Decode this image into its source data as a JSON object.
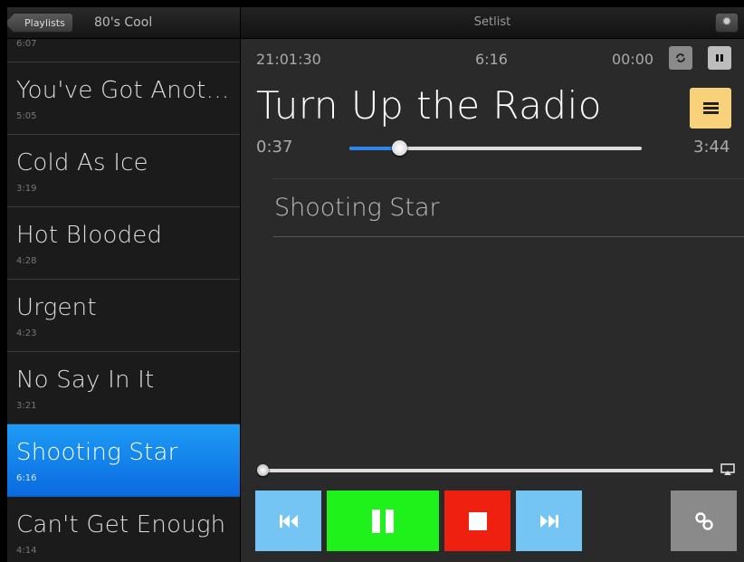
{
  "sidebar": {
    "back_label": "Playlists",
    "playlist_name": "80's Cool",
    "partial_duration": "6:07",
    "songs": [
      {
        "title": "You've Got Anoth...",
        "duration": "5:05"
      },
      {
        "title": "Cold As Ice",
        "duration": "3:19"
      },
      {
        "title": "Hot Blooded",
        "duration": "4:28"
      },
      {
        "title": "Urgent",
        "duration": "4:23"
      },
      {
        "title": "No Say In It",
        "duration": "3:21"
      },
      {
        "title": "Shooting Star",
        "duration": "6:16"
      },
      {
        "title": "Can't Get Enough",
        "duration": "4:14"
      }
    ],
    "active_index": 5
  },
  "header": {
    "title": "Setlist",
    "settings_icon": "gear-icon"
  },
  "status": {
    "clock": "21:01:30",
    "song_length": "6:16",
    "counter": "00:00"
  },
  "now_playing": {
    "title": "Turn Up the Radio",
    "elapsed": "0:37",
    "remaining": "3:44",
    "progress_fraction": 0.17
  },
  "next": {
    "title": "Shooting Star"
  },
  "volume": {
    "level_fraction": 0.0
  },
  "controls": {
    "prev_icon": "skip-back-icon",
    "play_pause_icon": "pause-icon",
    "stop_icon": "stop-icon",
    "next_icon": "skip-forward-icon",
    "link_icon": "link-icon"
  },
  "colors": {
    "accent_blue": "#1e9cf5",
    "play_green": "#1ff21a",
    "stop_red": "#f02010",
    "skip_blue": "#74c4f4",
    "list_yellow": "#f8d27a"
  }
}
